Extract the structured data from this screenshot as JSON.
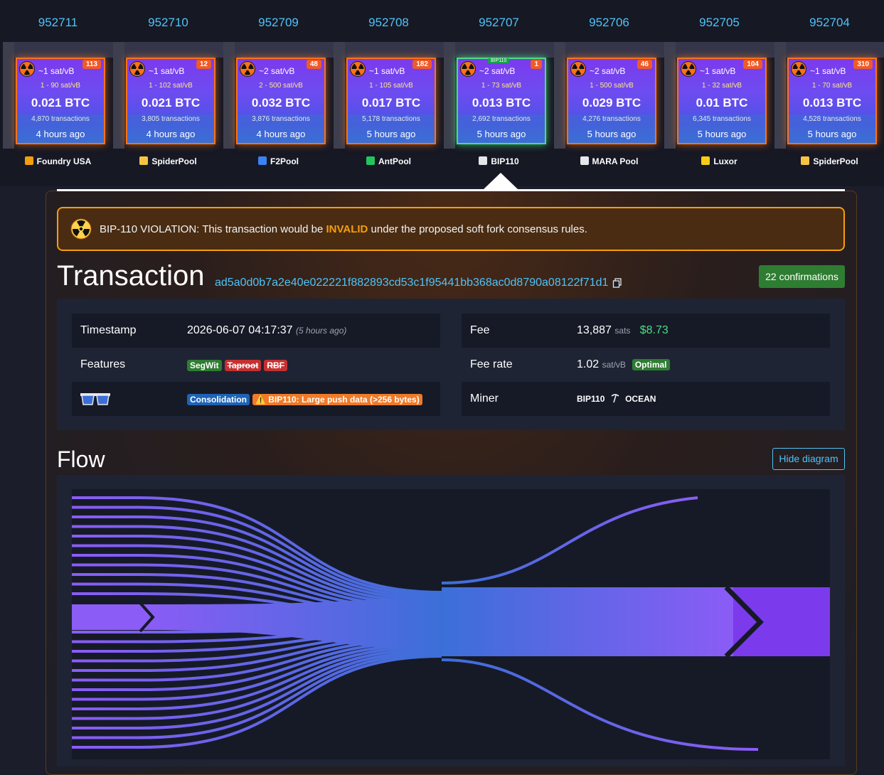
{
  "blocks": [
    {
      "height": "952711",
      "fee": "~1 sat/vB",
      "badge": "113",
      "range": "1 - 90 sat/vB",
      "amount": "0.021 BTC",
      "txs": "4,870 transactions",
      "ago": "4 hours ago",
      "pool": "Foundry USA",
      "pool_icon": "foundry-icon"
    },
    {
      "height": "952710",
      "fee": "~1 sat/vB",
      "badge": "12",
      "range": "1 - 102 sat/vB",
      "amount": "0.021 BTC",
      "txs": "3,805 transactions",
      "ago": "4 hours ago",
      "pool": "SpiderPool",
      "pool_icon": "spiderpool-icon"
    },
    {
      "height": "952709",
      "fee": "~2 sat/vB",
      "badge": "48",
      "range": "2 - 500 sat/vB",
      "amount": "0.032 BTC",
      "txs": "3,876 transactions",
      "ago": "4 hours ago",
      "pool": "F2Pool",
      "pool_icon": "f2pool-icon"
    },
    {
      "height": "952708",
      "fee": "~1 sat/vB",
      "badge": "182",
      "range": "1 - 105 sat/vB",
      "amount": "0.017 BTC",
      "txs": "5,178 transactions",
      "ago": "5 hours ago",
      "pool": "AntPool",
      "pool_icon": "antpool-icon"
    },
    {
      "height": "952707",
      "fee": "~2 sat/vB",
      "badge": "1",
      "range": "1 - 73 sat/vB",
      "amount": "0.013 BTC",
      "txs": "2,692 transactions",
      "ago": "5 hours ago",
      "pool": "BIP110",
      "pool_icon": "ocean-icon",
      "tag": "BIP110"
    },
    {
      "height": "952706",
      "fee": "~2 sat/vB",
      "badge": "46",
      "range": "1 - 500 sat/vB",
      "amount": "0.029 BTC",
      "txs": "4,276 transactions",
      "ago": "5 hours ago",
      "pool": "MARA Pool",
      "pool_icon": "mara-icon"
    },
    {
      "height": "952705",
      "fee": "~1 sat/vB",
      "badge": "104",
      "range": "1 - 32 sat/vB",
      "amount": "0.01 BTC",
      "txs": "6,345 transactions",
      "ago": "5 hours ago",
      "pool": "Luxor",
      "pool_icon": "luxor-icon"
    },
    {
      "height": "952704",
      "fee": "~1 sat/vB",
      "badge": "310",
      "range": "1 - 70 sat/vB",
      "amount": "0.013 BTC",
      "txs": "4,528 transactions",
      "ago": "5 hours ago",
      "pool": "SpiderPool",
      "pool_icon": "spiderpool-icon"
    }
  ],
  "violation": {
    "prefix": "BIP-110 VIOLATION: This transaction would be ",
    "emphasis": "INVALID",
    "suffix": " under the proposed soft fork consensus rules."
  },
  "transaction": {
    "title": "Transaction",
    "txid": "ad5a0d0b7a2e40e022221f882893cd53c1f95441bb368ac0d8790a08122f71d1",
    "confirmations": "22 confirmations"
  },
  "details": {
    "timestamp_label": "Timestamp",
    "timestamp_value": "2026-06-07 04:17:37",
    "timestamp_ago": "(5 hours ago)",
    "features_label": "Features",
    "feature_segwit": "SegWit",
    "feature_taproot": "Taproot",
    "feature_rbf": "RBF",
    "tag_consolidation": "Consolidation",
    "tag_bip110": "⚠️ BIP110: Large push data (>256 bytes)",
    "fee_label": "Fee",
    "fee_sats": "13,887",
    "fee_unit": "sats",
    "fee_usd": "$8.73",
    "feerate_label": "Fee rate",
    "feerate_value": "1.02",
    "feerate_unit": "sat/vB",
    "feerate_badge": "Optimal",
    "miner_label": "Miner",
    "miner_name": "BIP110",
    "miner_pool": "OCEAN"
  },
  "flow": {
    "title": "Flow",
    "hide_label": "Hide diagram"
  },
  "colors": {
    "accent": "#4fc3f7",
    "warning": "#f59e0b",
    "confirm_green": "#2e7d32",
    "flow_purple": "#8b5cf6",
    "flow_blue": "#3b6fd8"
  }
}
